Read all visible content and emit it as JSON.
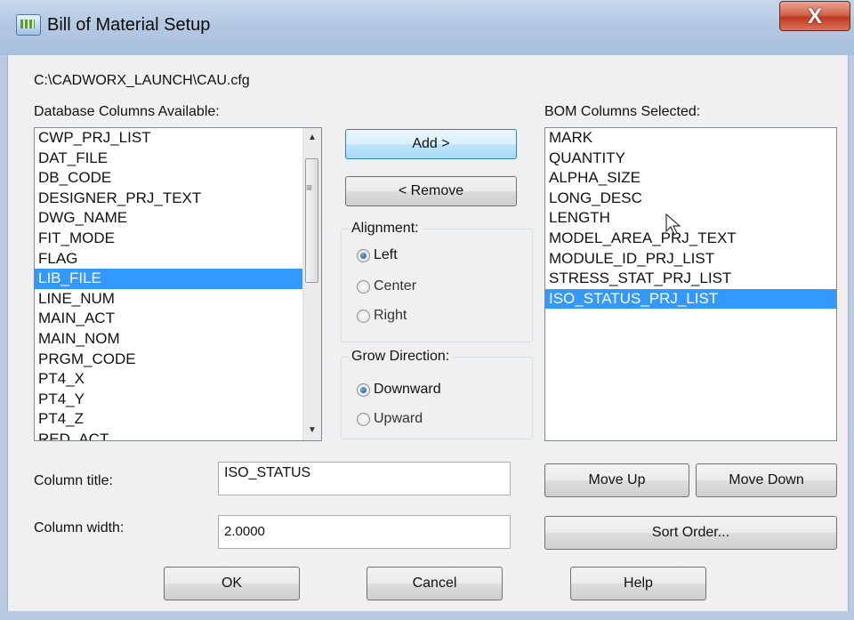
{
  "window": {
    "title": "Bill of Material Setup",
    "close_label": "X"
  },
  "config_path": "C:\\CADWORX_LAUNCH\\CAU.cfg",
  "available": {
    "label": "Database Columns Available:",
    "items": [
      "CWP_PRJ_LIST",
      "DAT_FILE",
      "DB_CODE",
      "DESIGNER_PRJ_TEXT",
      "DWG_NAME",
      "FIT_MODE",
      "FLAG",
      "LIB_FILE",
      "LINE_NUM",
      "MAIN_ACT",
      "MAIN_NOM",
      "PRGM_CODE",
      "PT4_X",
      "PT4_Y",
      "PT4_Z",
      "RED_ACT"
    ],
    "selected": "LIB_FILE"
  },
  "selected_columns": {
    "label": "BOM Columns Selected:",
    "items": [
      "MARK",
      "QUANTITY",
      "ALPHA_SIZE",
      "LONG_DESC",
      "LENGTH",
      "MODEL_AREA_PRJ_TEXT",
      "MODULE_ID_PRJ_LIST",
      "STRESS_STAT_PRJ_LIST",
      "ISO_STATUS_PRJ_LIST"
    ],
    "selected": "ISO_STATUS_PRJ_LIST"
  },
  "buttons": {
    "add": "Add >",
    "remove": "< Remove",
    "move_up": "Move Up",
    "move_down": "Move Down",
    "sort_order": "Sort Order...",
    "ok": "OK",
    "cancel": "Cancel",
    "help": "Help"
  },
  "alignment": {
    "label": "Alignment:",
    "options": [
      "Left",
      "Center",
      "Right"
    ],
    "selected": "Left"
  },
  "grow_direction": {
    "label": "Grow Direction:",
    "options": [
      "Downward",
      "Upward"
    ],
    "selected": "Downward"
  },
  "column_title": {
    "label": "Column title:",
    "value": "ISO_STATUS"
  },
  "column_width": {
    "label": "Column width:",
    "value": "2.0000"
  },
  "icons": {
    "app": "app-icon",
    "close": "close-icon",
    "scroll_up": "scroll-up-icon",
    "scroll_down": "scroll-down-icon"
  },
  "colors": {
    "selection": "#3399ff",
    "titlebar": "#b4c9e3",
    "close": "#c0391f"
  }
}
